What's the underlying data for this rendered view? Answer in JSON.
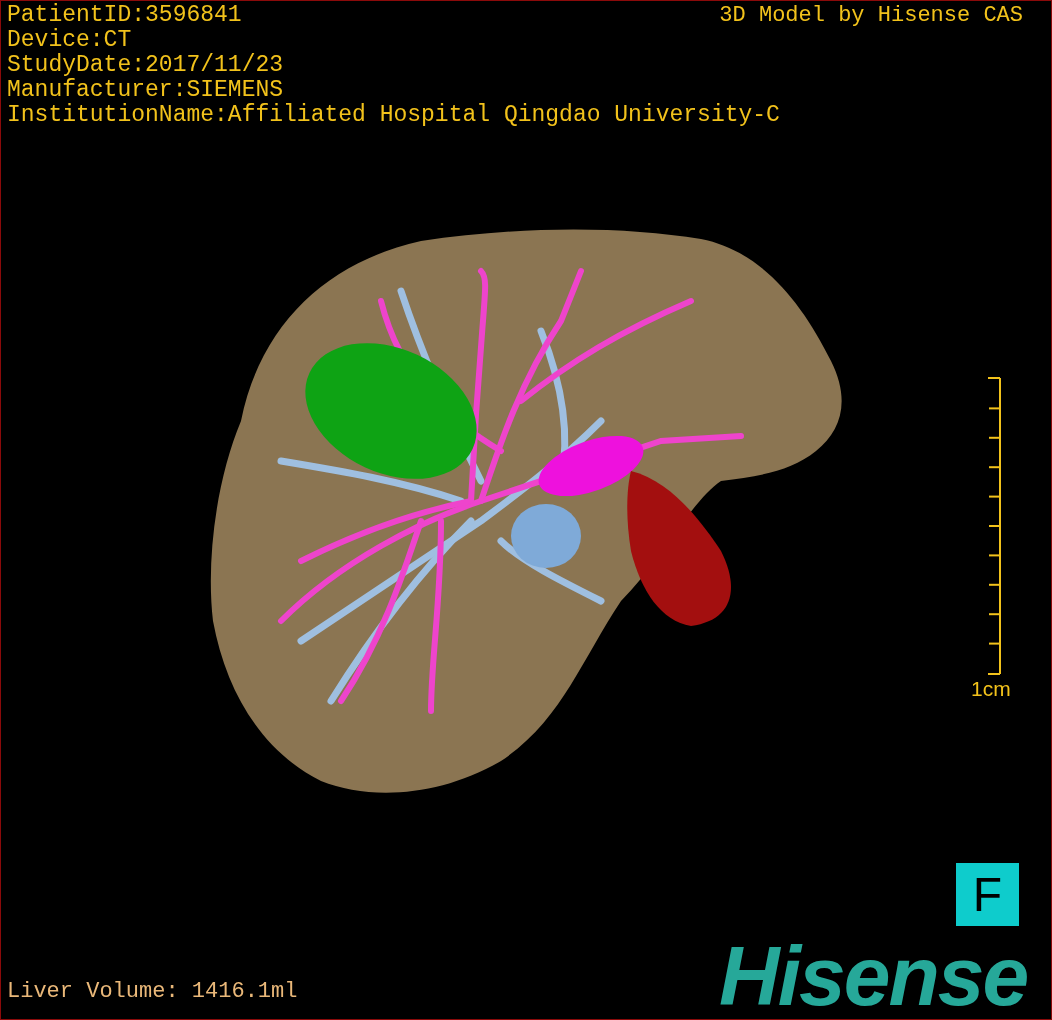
{
  "info_lines": [
    "PatientID:3596841",
    "Device:CT",
    "StudyDate:2017/11/23",
    "Manufacturer:SIEMENS",
    "InstitutionName:Affiliated Hospital Qingdao University-C"
  ],
  "title": "3D Model by Hisense CAS",
  "scale_bar": {
    "label": "1cm"
  },
  "orientation_label": "F",
  "logo": "Hisense",
  "liver_volume": "Liver Volume: 1416.1ml"
}
